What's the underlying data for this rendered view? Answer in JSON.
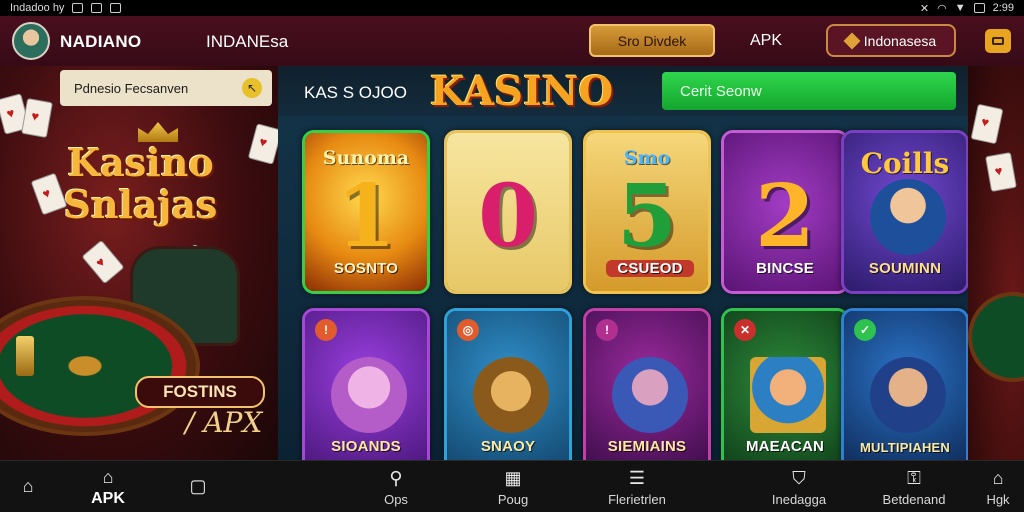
{
  "status_bar": {
    "left_text": "Indadoo hy",
    "right_text": "2:99"
  },
  "header": {
    "brand": "NADIANO",
    "region": "INDANEsa",
    "primary_button": "Sro Divdek",
    "apk_link": "APK",
    "language_button": "Indonasesa"
  },
  "left_banner": {
    "promo_text": "Pdnesio Fecsanven",
    "title_line1": "Kasino",
    "title_line2": "Snlajas",
    "badge_text": "FOSTINS",
    "badge_sub": "/ APX"
  },
  "center": {
    "section_label": "KAS S OJOO",
    "logo_text": "KASINO",
    "cta_button": "Cerit Seonw"
  },
  "games": [
    {
      "head": "Sunoma",
      "big": "1",
      "label": "SOSNTO"
    },
    {
      "head": "",
      "big": "0",
      "label": ""
    },
    {
      "head": "Smo",
      "big": "5",
      "label": "CSUEOD"
    },
    {
      "head": "",
      "big": "2",
      "label": "BINCSE"
    },
    {
      "head": "Coills",
      "big": "",
      "label": "SOUMINN"
    },
    {
      "head": "",
      "big": "",
      "label": "SIOANDS"
    },
    {
      "head": "",
      "big": "",
      "label": "SNAOY"
    },
    {
      "head": "",
      "big": "",
      "label": "SIEMIAINS"
    },
    {
      "head": "",
      "big": "",
      "label": "MAEACAN"
    },
    {
      "head": "",
      "big": "",
      "label": "MULTIPIAHEN"
    }
  ],
  "bottom_nav": [
    {
      "label": "",
      "icon": "home-icon"
    },
    {
      "label": "APK",
      "icon": "apk-home-icon"
    },
    {
      "label": "",
      "icon": "bag-icon"
    },
    {
      "label": "Ops",
      "icon": "search-icon"
    },
    {
      "label": "Poug",
      "icon": "grid-icon"
    },
    {
      "label": "Flerietrlen",
      "icon": "filter-icon"
    },
    {
      "label": "Inedagga",
      "icon": "shield-icon"
    },
    {
      "label": "Betdenand",
      "icon": "key-icon"
    },
    {
      "label": "Hgk",
      "icon": "house-icon"
    }
  ]
}
